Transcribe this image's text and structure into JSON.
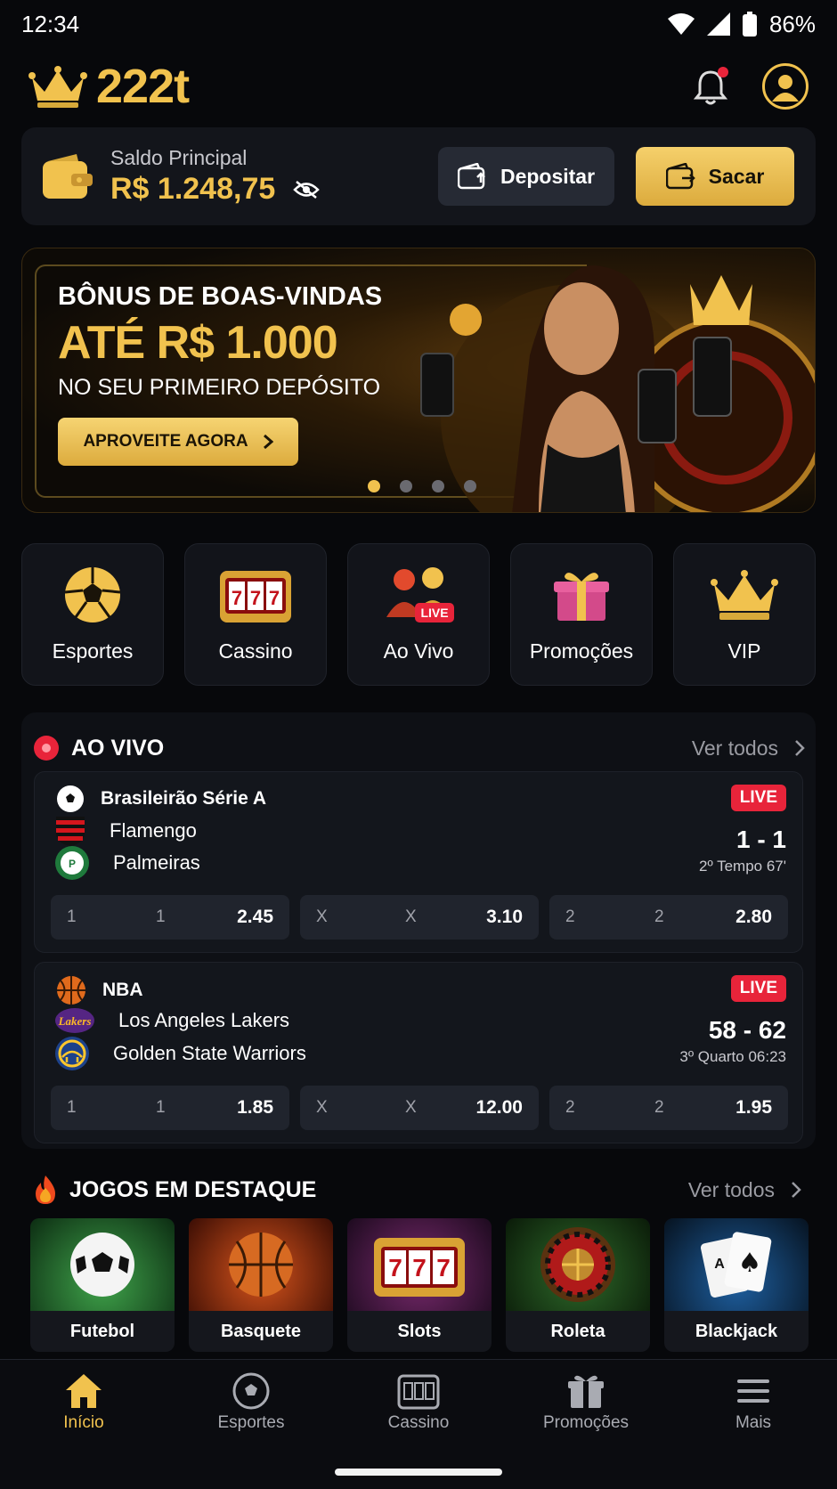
{
  "status": {
    "time": "12:34",
    "battery": "86%"
  },
  "brand": {
    "name": "222t"
  },
  "balance": {
    "label": "Saldo Principal",
    "value": "R$ 1.248,75",
    "deposit_label": "Depositar",
    "withdraw_label": "Sacar"
  },
  "banner": {
    "line1": "BÔNUS DE BOAS-VINDAS",
    "line2": "ATÉ R$ 1.000",
    "line3": "NO SEU PRIMEIRO DEPÓSITO",
    "cta": "APROVEITE AGORA",
    "dots_total": 4,
    "active_dot": 1,
    "brand_mark": "222t"
  },
  "categories": [
    {
      "label": "Esportes",
      "icon": "soccer-ball-icon"
    },
    {
      "label": "Cassino",
      "icon": "slot-machine-icon"
    },
    {
      "label": "Ao Vivo",
      "icon": "live-dealers-icon",
      "badge": "LIVE"
    },
    {
      "label": "Promoções",
      "icon": "gift-icon"
    },
    {
      "label": "VIP",
      "icon": "crown-icon"
    }
  ],
  "live": {
    "title": "AO VIVO",
    "see_all": "Ver todos",
    "matches": [
      {
        "league": "Brasileirão Série A",
        "league_icon": "soccer-ball-icon",
        "badge": "LIVE",
        "team_a": "Flamengo",
        "team_b": "Palmeiras",
        "score": "1 - 1",
        "period": "2º Tempo 67'",
        "odds": [
          {
            "k1": "1",
            "k2": "1",
            "value": "2.45"
          },
          {
            "k1": "X",
            "k2": "X",
            "value": "3.10"
          },
          {
            "k1": "2",
            "k2": "2",
            "value": "2.80"
          }
        ]
      },
      {
        "league": "NBA",
        "league_icon": "basketball-icon",
        "badge": "LIVE",
        "team_a": "Los Angeles Lakers",
        "team_b": "Golden State Warriors",
        "score": "58 - 62",
        "period": "3º Quarto 06:23",
        "odds": [
          {
            "k1": "1",
            "k2": "1",
            "value": "1.85"
          },
          {
            "k1": "X",
            "k2": "X",
            "value": "12.00"
          },
          {
            "k1": "2",
            "k2": "2",
            "value": "1.95"
          }
        ]
      }
    ]
  },
  "featured": {
    "title": "JOGOS EM DESTAQUE",
    "see_all": "Ver todos",
    "games": [
      {
        "label": "Futebol",
        "icon": "soccer-ball-icon"
      },
      {
        "label": "Basquete",
        "icon": "basketball-icon"
      },
      {
        "label": "Slots",
        "icon": "slot-machine-icon"
      },
      {
        "label": "Roleta",
        "icon": "roulette-icon"
      },
      {
        "label": "Blackjack",
        "icon": "playing-cards-icon"
      }
    ]
  },
  "nav": [
    {
      "label": "Início",
      "icon": "home-icon",
      "active": true
    },
    {
      "label": "Esportes",
      "icon": "soccer-ball-icon"
    },
    {
      "label": "Cassino",
      "icon": "slot-machine-icon"
    },
    {
      "label": "Promoções",
      "icon": "gift-icon"
    },
    {
      "label": "Mais",
      "icon": "menu-icon"
    }
  ],
  "colors": {
    "gold": "#f1c24e",
    "live_red": "#e8243a",
    "background": "#07080b",
    "card": "#13151b"
  }
}
